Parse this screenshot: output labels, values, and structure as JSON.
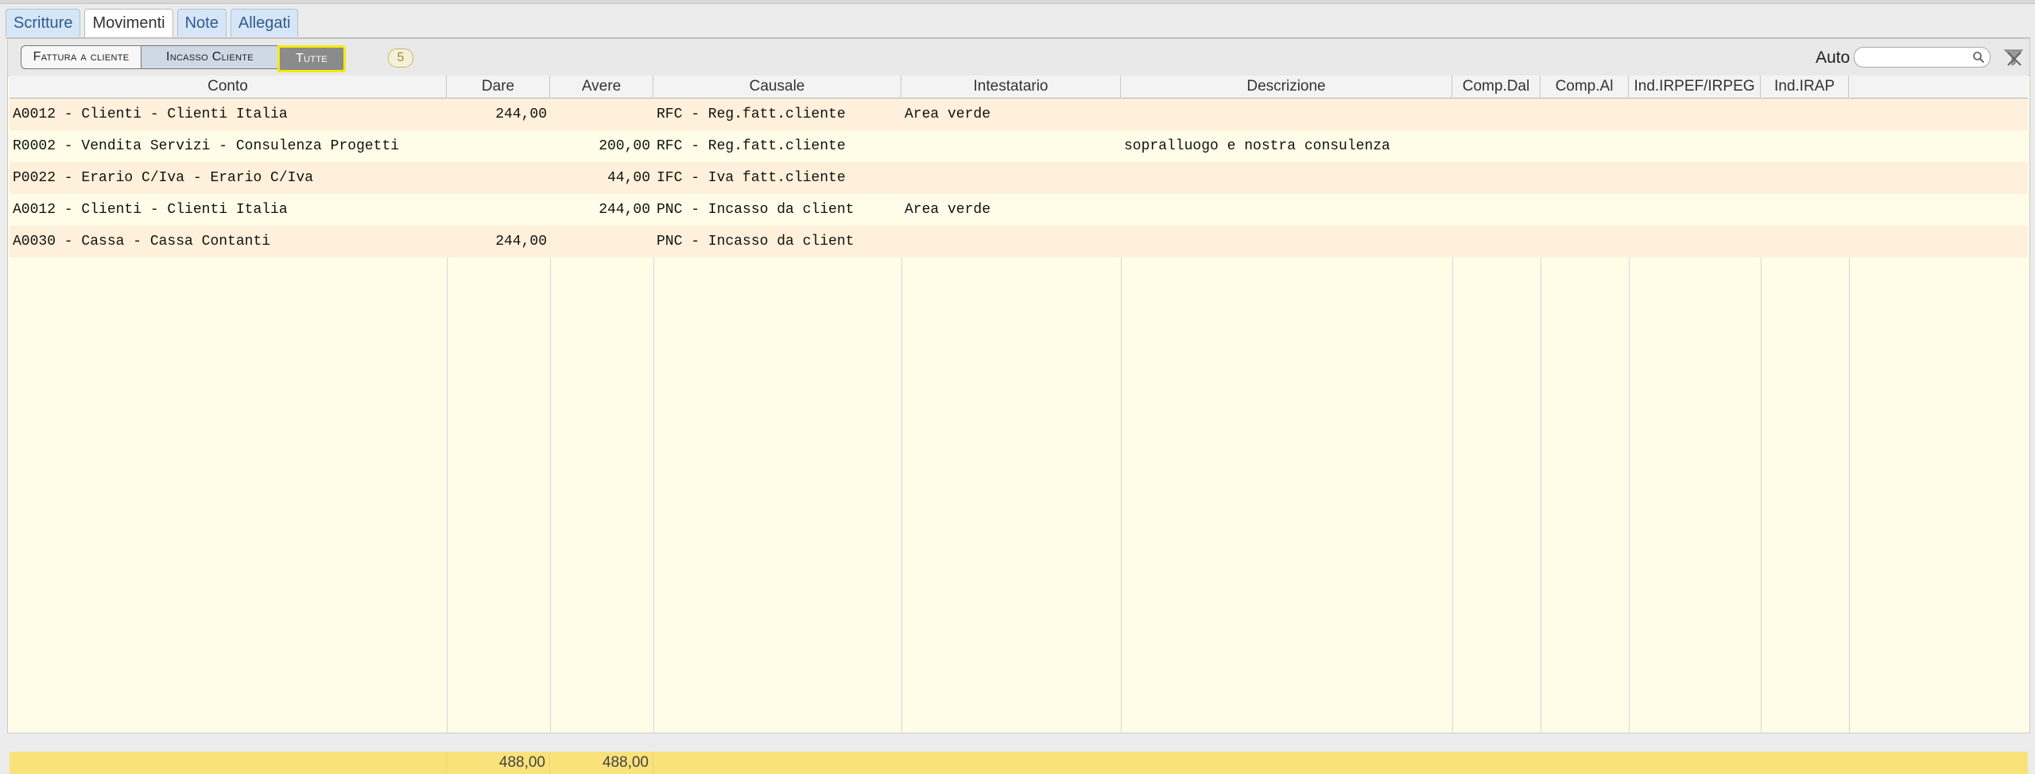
{
  "tabs": [
    {
      "label": "Scritture"
    },
    {
      "label": "Movimenti"
    },
    {
      "label": "Note"
    },
    {
      "label": "Allegati"
    }
  ],
  "active_tab": "Movimenti",
  "filter": {
    "buttons": [
      "Fattura a cliente",
      "Incasso Cliente",
      "Tutte"
    ],
    "selected": "Tutte",
    "count": "5",
    "auto_label": "Auto",
    "search_value": ""
  },
  "columns": [
    "Conto",
    "Dare",
    "Avere",
    "Causale",
    "Intestatario",
    "Descrizione",
    "Comp.Dal",
    "Comp.Al",
    "Ind.IRPEF/IRPEG",
    "Ind.IRAP"
  ],
  "rows": [
    {
      "conto": "A0012 - Clienti - Clienti Italia",
      "dare": "244,00",
      "avere": "",
      "causale": "RFC - Reg.fatt.cliente",
      "intestatario": "Area verde",
      "descrizione": ""
    },
    {
      "conto": "R0002 - Vendita Servizi - Consulenza Progetti",
      "dare": "",
      "avere": "200,00",
      "causale": "RFC - Reg.fatt.cliente",
      "intestatario": "",
      "descrizione": "sopralluogo e nostra consulenza"
    },
    {
      "conto": "P0022 - Erario C/Iva - Erario C/Iva",
      "dare": "",
      "avere": "44,00",
      "causale": "IFC - Iva fatt.cliente",
      "intestatario": "",
      "descrizione": ""
    },
    {
      "conto": "A0012 - Clienti - Clienti Italia",
      "dare": "",
      "avere": "244,00",
      "causale": "PNC - Incasso da client",
      "intestatario": "Area verde",
      "descrizione": ""
    },
    {
      "conto": "A0030 - Cassa - Cassa Contanti",
      "dare": "244,00",
      "avere": "",
      "causale": "PNC - Incasso da client",
      "intestatario": "",
      "descrizione": ""
    }
  ],
  "totals": {
    "dare": "488,00",
    "avere": "488,00"
  },
  "colors": {
    "row_odd": "#fef0da",
    "row_even": "#fffde8",
    "totals": "#fae27a",
    "selected_highlight": "#f4ea0a"
  }
}
